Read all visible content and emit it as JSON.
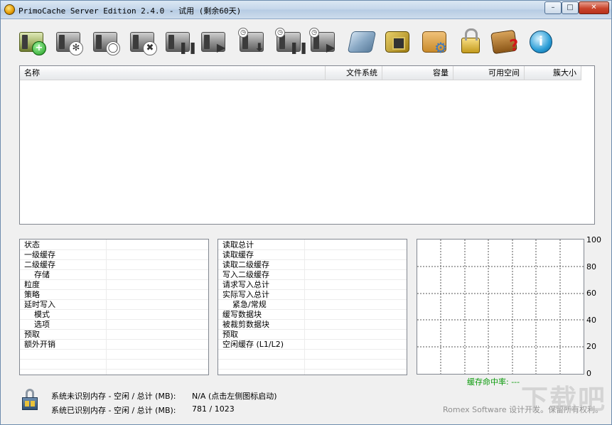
{
  "window": {
    "title": "PrimoCache Server Edition 2.4.0 - 试用 (剩余60天)",
    "controls": {
      "minimize": "–",
      "maximize": "□",
      "close": "✕"
    }
  },
  "toolbar": [
    {
      "name": "new-cache-task-button",
      "icon": "drive-add-icon",
      "glyph": "+"
    },
    {
      "name": "cache-settings-button",
      "icon": "drive-gear-icon",
      "glyph": "✻"
    },
    {
      "name": "cache-statistics-button",
      "icon": "drive-magnifier-icon",
      "glyph": "◯"
    },
    {
      "name": "delete-cache-task-button",
      "icon": "drive-delete-icon",
      "glyph": "✖"
    },
    {
      "name": "pause-cache-button",
      "icon": "drive-pause-icon",
      "glyph": "❚❚"
    },
    {
      "name": "resume-cache-button",
      "icon": "drive-play-icon",
      "glyph": "▶"
    },
    {
      "name": "flush-deferred-write-button",
      "icon": "drive-flush-icon",
      "glyph": "⬇"
    },
    {
      "name": "pause-deferred-write-button",
      "icon": "drive-clock-pause-icon",
      "glyph": "❚❚"
    },
    {
      "name": "resume-deferred-write-button",
      "icon": "drive-clock-play-icon",
      "glyph": "▶"
    },
    {
      "name": "tools-button",
      "icon": "tools-icon"
    },
    {
      "name": "hardware-info-button",
      "icon": "memory-chip-icon"
    },
    {
      "name": "options-button",
      "icon": "package-gear-icon"
    },
    {
      "name": "license-button",
      "icon": "lock-key-icon"
    },
    {
      "name": "help-button",
      "icon": "help-book-icon"
    },
    {
      "name": "about-button",
      "icon": "info-icon",
      "glyph": "i"
    }
  ],
  "drive_list": {
    "columns": [
      "名称",
      "文件系统",
      "容量",
      "可用空间",
      "簇大小"
    ],
    "rows": []
  },
  "left_info": {
    "rows": [
      {
        "label": "状态",
        "indent": false
      },
      {
        "label": "一级缓存",
        "indent": false
      },
      {
        "label": "二级缓存",
        "indent": false
      },
      {
        "label": "存储",
        "indent": true
      },
      {
        "label": "粒度",
        "indent": false
      },
      {
        "label": "策略",
        "indent": false
      },
      {
        "label": "延时写入",
        "indent": false
      },
      {
        "label": "模式",
        "indent": true
      },
      {
        "label": "选项",
        "indent": true
      },
      {
        "label": "预取",
        "indent": false
      },
      {
        "label": "额外开销",
        "indent": false
      }
    ]
  },
  "right_info": {
    "rows": [
      {
        "label": "读取总计",
        "indent": false
      },
      {
        "label": "读取缓存",
        "indent": false
      },
      {
        "label": "读取二级缓存",
        "indent": false
      },
      {
        "label": "写入二级缓存",
        "indent": false
      },
      {
        "label": "请求写入总计",
        "indent": false
      },
      {
        "label": "实际写入总计",
        "indent": false
      },
      {
        "label": "紧急/常规",
        "indent": true
      },
      {
        "label": "缓写数据块",
        "indent": false
      },
      {
        "label": "被裁剪数据块",
        "indent": false
      },
      {
        "label": "预取",
        "indent": false
      },
      {
        "label": "空闲缓存 (L1/L2)",
        "indent": false
      }
    ]
  },
  "hit_chart": {
    "y_ticks": [
      "100",
      "80",
      "60",
      "40",
      "20",
      "0"
    ],
    "label": "缓存命中率: ---"
  },
  "memory": {
    "unrecognized_label": "系统未识别内存 - 空闲 / 总计 (MB):",
    "unrecognized_value": "N/A (点击左侧图标启动)",
    "recognized_label": "系统已识别内存 - 空闲 / 总计 (MB):",
    "recognized_value": "781 / 1023"
  },
  "footer": "Romex Software 设计开发。保留所有权利。",
  "watermark": "下载吧"
}
